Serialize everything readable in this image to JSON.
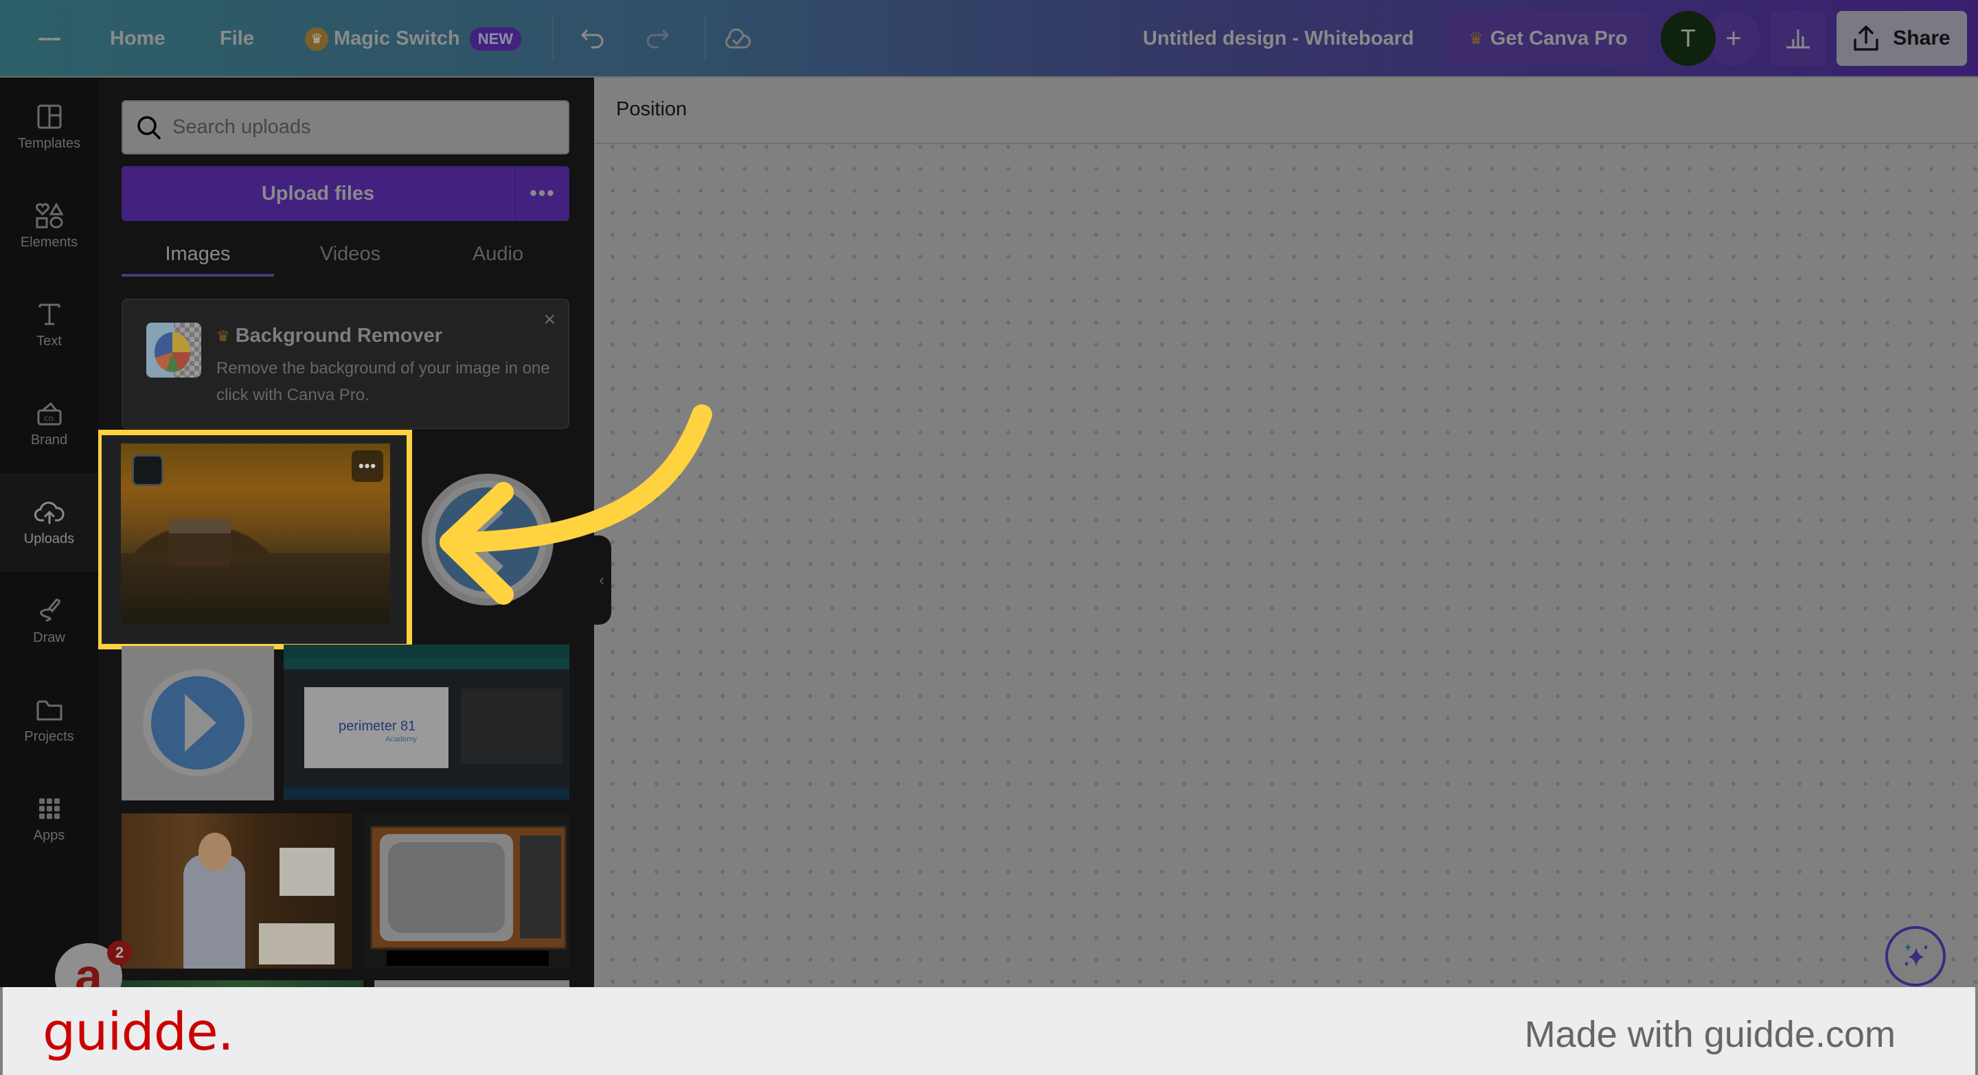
{
  "topbar": {
    "menu_icon": "hamburger-icon",
    "home_label": "Home",
    "file_label": "File",
    "magic_switch_label": "Magic Switch",
    "magic_switch_badge": "NEW",
    "undo_icon": "undo-icon",
    "redo_icon": "redo-icon",
    "save_status_icon": "cloud-check-icon",
    "design_title": "Untitled design - Whiteboard",
    "get_pro_label": "Get Canva Pro",
    "avatar_initial": "T",
    "add_collaborator_icon": "plus-icon",
    "insights_icon": "bar-chart-icon",
    "share_label": "Share"
  },
  "sidebar": {
    "items": [
      {
        "label": "Templates",
        "icon": "templates-icon"
      },
      {
        "label": "Elements",
        "icon": "elements-icon"
      },
      {
        "label": "Text",
        "icon": "text-icon"
      },
      {
        "label": "Brand",
        "icon": "brand-icon"
      },
      {
        "label": "Uploads",
        "icon": "upload-cloud-icon",
        "active": true
      },
      {
        "label": "Draw",
        "icon": "draw-icon"
      },
      {
        "label": "Projects",
        "icon": "folder-icon"
      },
      {
        "label": "Apps",
        "icon": "apps-grid-icon"
      }
    ]
  },
  "uploads_panel": {
    "search_placeholder": "Search uploads",
    "upload_button_label": "Upload files",
    "more_label": "•••",
    "tabs": [
      {
        "label": "Images",
        "active": true
      },
      {
        "label": "Videos",
        "active": false
      },
      {
        "label": "Audio",
        "active": false
      }
    ],
    "promo": {
      "title": "Background Remover",
      "description": "Remove the background of your image in one click with Canva Pro.",
      "close_label": "×"
    },
    "thumbnails": [
      {
        "name": "autumn-lake-gazebo",
        "highlighted": true,
        "more_label": "•••"
      },
      {
        "name": "back-arrow-circle-icon"
      },
      {
        "name": "play-button-circle-icon"
      },
      {
        "name": "youtube-perimeter81-screenshot",
        "caption": "perimeter 81",
        "subcaption": "Academy"
      },
      {
        "name": "retro-computer-man-photo"
      },
      {
        "name": "vintage-tv"
      },
      {
        "name": "green-image"
      },
      {
        "name": "gray-image"
      }
    ],
    "collapse_label": "‹"
  },
  "canvas": {
    "toolbar_label": "Position",
    "magic_button_icon": "sparkles-icon"
  },
  "overlay": {
    "guidde_badge_letter": "a",
    "guidde_badge_count": "2",
    "footer_brand": "guidde.",
    "footer_text": "Made with guidde.com",
    "annotation": "arrow-pointing-left",
    "highlight_color": "#ffd23f"
  }
}
